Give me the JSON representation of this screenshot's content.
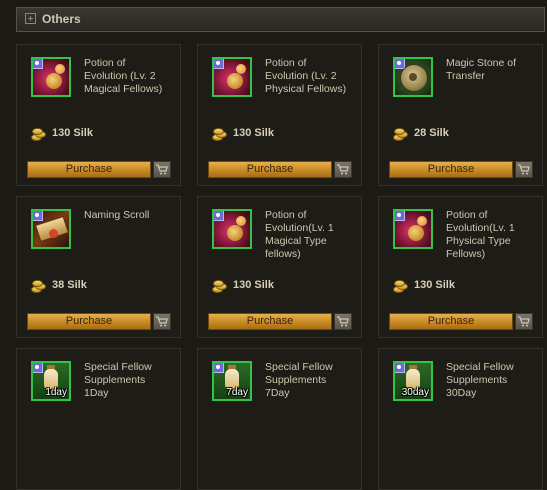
{
  "section": {
    "title": "Others"
  },
  "items": [
    {
      "name_lines": [
        "Potion of",
        "Evolution (Lv. 2",
        "Magical Fellows)"
      ],
      "price": "130 Silk",
      "button": "Purchase",
      "icon": "potion-icon",
      "day_tag": ""
    },
    {
      "name_lines": [
        "Potion of",
        "Evolution (Lv. 2",
        "Physical Fellows)"
      ],
      "price": "130 Silk",
      "button": "Purchase",
      "icon": "potion-icon",
      "day_tag": ""
    },
    {
      "name_lines": [
        "Magic Stone of",
        "Transfer"
      ],
      "price": "28 Silk",
      "button": "Purchase",
      "icon": "magic-stone-icon",
      "day_tag": ""
    },
    {
      "name_lines": [
        "Naming Scroll"
      ],
      "price": "38 Silk",
      "button": "Purchase",
      "icon": "scroll-icon",
      "day_tag": ""
    },
    {
      "name_lines": [
        "Potion of",
        "Evolution(Lv. 1",
        "Magical Type",
        "fellows)"
      ],
      "price": "130 Silk",
      "button": "Purchase",
      "icon": "potion-icon",
      "day_tag": ""
    },
    {
      "name_lines": [
        "Potion of",
        "Evolution(Lv. 1",
        "Physical Type",
        "Fellows)"
      ],
      "price": "130 Silk",
      "button": "Purchase",
      "icon": "potion-icon",
      "day_tag": ""
    },
    {
      "name_lines": [
        "Special Fellow",
        "Supplements",
        "1Day"
      ],
      "price": "",
      "button": "",
      "icon": "supplement-icon",
      "day_tag": "1day"
    },
    {
      "name_lines": [
        "Special Fellow",
        "Supplements",
        "7Day"
      ],
      "price": "",
      "button": "",
      "icon": "supplement-icon",
      "day_tag": "7day"
    },
    {
      "name_lines": [
        "Special Fellow",
        "Supplements",
        "30Day"
      ],
      "price": "",
      "button": "",
      "icon": "supplement-icon",
      "day_tag": "30day"
    }
  ]
}
